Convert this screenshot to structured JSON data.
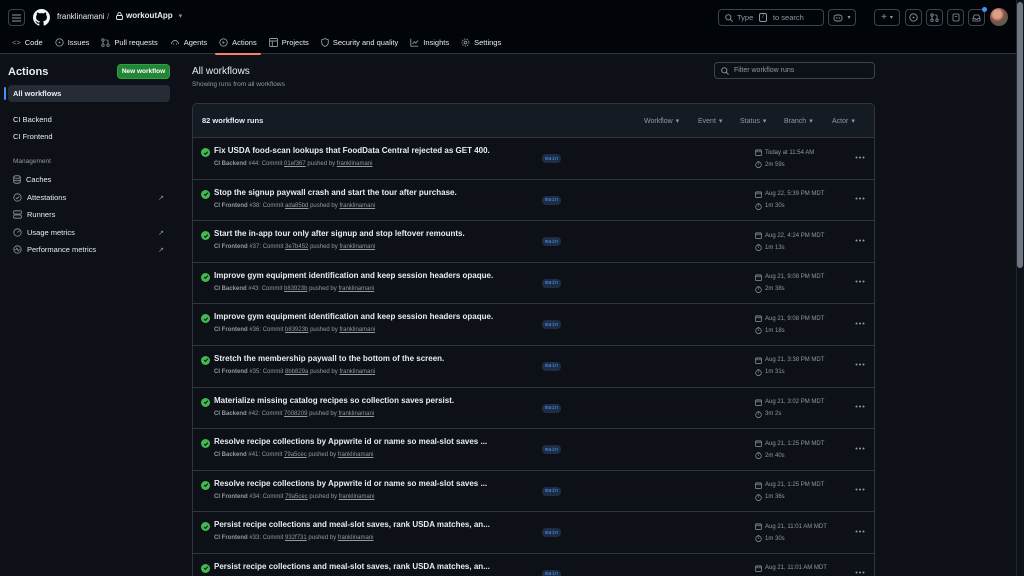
{
  "header": {
    "owner": "franklinamani",
    "slash": "/",
    "repo": "workoutApp",
    "search_prefix": "Type",
    "search_key": "/",
    "search_suffix": "to search"
  },
  "tabs": [
    {
      "label": "Code",
      "icon": "code-icon"
    },
    {
      "label": "Issues",
      "icon": "issue-opened-icon"
    },
    {
      "label": "Pull requests",
      "icon": "git-pull-request-icon"
    },
    {
      "label": "Agents",
      "icon": "agent-icon"
    },
    {
      "label": "Actions",
      "icon": "play-icon"
    },
    {
      "label": "Projects",
      "icon": "table-icon"
    },
    {
      "label": "Security and quality",
      "icon": "shield-icon"
    },
    {
      "label": "Insights",
      "icon": "graph-icon"
    },
    {
      "label": "Settings",
      "icon": "gear-icon"
    }
  ],
  "sidebar": {
    "title": "Actions",
    "new_workflow": "New workflow",
    "all_workflows": "All workflows",
    "workflows": [
      "CI Backend",
      "CI Frontend"
    ],
    "management_label": "Management",
    "management": [
      {
        "label": "Caches",
        "icon": "database-icon"
      },
      {
        "label": "Attestations",
        "icon": "verified-icon",
        "external": "↗"
      },
      {
        "label": "Runners",
        "icon": "server-icon"
      },
      {
        "label": "Usage metrics",
        "icon": "meter-icon",
        "external": "↗"
      },
      {
        "label": "Performance metrics",
        "icon": "pulse-icon",
        "external": "↗"
      }
    ]
  },
  "main": {
    "title": "All workflows",
    "subtitle": "Showing runs from all workflows",
    "filter_placeholder": "Filter workflow runs",
    "runs_count": "82 workflow runs",
    "filters": [
      "Workflow",
      "Event",
      "Status",
      "Branch",
      "Actor"
    ]
  },
  "runs": [
    {
      "title": "Fix USDA food-scan lookups that FoodData Central rejected as GET 400.",
      "workflow": "CI Backend",
      "num": "#44",
      "commit": "01ef367",
      "pushed_by": "pushed by",
      "user": "franklinamani",
      "branch": "main",
      "date": "Today at 11:54 AM",
      "duration": "2m 59s"
    },
    {
      "title": "Stop the signup paywall crash and start the tour after purchase.",
      "workflow": "CI Frontend",
      "num": "#38",
      "commit": "ada85bd",
      "pushed_by": "pushed by",
      "user": "franklinamani",
      "branch": "main",
      "date": "Aug 22, 5:39 PM MDT",
      "duration": "1m 30s"
    },
    {
      "title": "Start the in-app tour only after signup and stop leftover remounts.",
      "workflow": "CI Frontend",
      "num": "#37",
      "commit": "3e7b452",
      "pushed_by": "pushed by",
      "user": "franklinamani",
      "branch": "main",
      "date": "Aug 22, 4:24 PM MDT",
      "duration": "1m 13s"
    },
    {
      "title": "Improve gym equipment identification and keep session headers opaque.",
      "workflow": "CI Backend",
      "num": "#43",
      "commit": "b83923b",
      "pushed_by": "pushed by",
      "user": "franklinamani",
      "branch": "main",
      "date": "Aug 21, 9:08 PM MDT",
      "duration": "2m 38s"
    },
    {
      "title": "Improve gym equipment identification and keep session headers opaque.",
      "workflow": "CI Frontend",
      "num": "#36",
      "commit": "b83923b",
      "pushed_by": "pushed by",
      "user": "franklinamani",
      "branch": "main",
      "date": "Aug 21, 9:08 PM MDT",
      "duration": "1m 18s"
    },
    {
      "title": "Stretch the membership paywall to the bottom of the screen.",
      "workflow": "CI Frontend",
      "num": "#35",
      "commit": "8bb829a",
      "pushed_by": "pushed by",
      "user": "franklinamani",
      "branch": "main",
      "date": "Aug 21, 3:38 PM MDT",
      "duration": "1m 31s"
    },
    {
      "title": "Materialize missing catalog recipes so collection saves persist.",
      "workflow": "CI Backend",
      "num": "#42",
      "commit": "7008209",
      "pushed_by": "pushed by",
      "user": "franklinamani",
      "branch": "main",
      "date": "Aug 21, 3:02 PM MDT",
      "duration": "3m 2s"
    },
    {
      "title": "Resolve recipe collections by Appwrite id or name so meal-slot saves ...",
      "workflow": "CI Backend",
      "num": "#41",
      "commit": "79a5cec",
      "pushed_by": "pushed by",
      "user": "franklinamani",
      "branch": "main",
      "date": "Aug 21, 1:25 PM MDT",
      "duration": "2m 40s"
    },
    {
      "title": "Resolve recipe collections by Appwrite id or name so meal-slot saves ...",
      "workflow": "CI Frontend",
      "num": "#34",
      "commit": "79a5cec",
      "pushed_by": "pushed by",
      "user": "franklinamani",
      "branch": "main",
      "date": "Aug 21, 1:25 PM MDT",
      "duration": "1m 36s"
    },
    {
      "title": "Persist recipe collections and meal-slot saves, rank USDA matches, an...",
      "workflow": "CI Frontend",
      "num": "#33",
      "commit": "932f731",
      "pushed_by": "pushed by",
      "user": "franklinamani",
      "branch": "main",
      "date": "Aug 21, 11:01 AM MDT",
      "duration": "1m 30s"
    },
    {
      "title": "Persist recipe collections and meal-slot saves, rank USDA matches, an...",
      "workflow": "",
      "num": "",
      "commit": "",
      "pushed_by": "",
      "user": "",
      "branch": "main",
      "date": "Aug 21, 11:01 AM MDT",
      "duration": ""
    }
  ]
}
